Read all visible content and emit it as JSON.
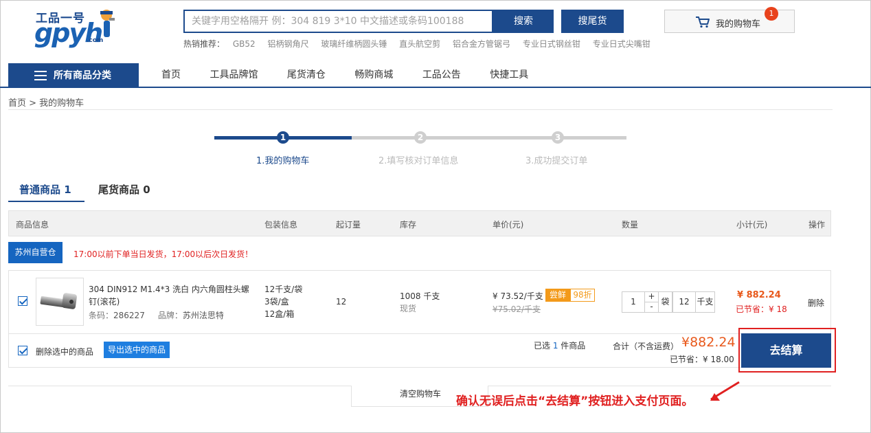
{
  "logo": {
    "cn": "工品一号",
    "en": "gpyh",
    "com": ".com"
  },
  "search": {
    "placeholder": "关键字用空格隔开 例：304 819 3*10 中文描述或条码100188",
    "search_btn": "搜索",
    "tail_btn": "搜尾货"
  },
  "hot": {
    "label": "热销推荐：",
    "keywords": [
      "GB52",
      "铝柄钢角尺",
      "玻璃纤维柄圆头锤",
      "直头航空剪",
      "铝合金方管锯弓",
      "专业日式钢丝钳",
      "专业日式尖嘴钳"
    ]
  },
  "cart": {
    "label": "我的购物车",
    "count": "1"
  },
  "nav": {
    "all_categories": "所有商品分类",
    "items": [
      "首页",
      "工具品牌馆",
      "尾货清仓",
      "畅购商城",
      "工品公告",
      "快捷工具"
    ]
  },
  "breadcrumb": "首页 > 我的购物车",
  "steps": [
    {
      "num": "1",
      "label": "1.我的购物车",
      "active": true
    },
    {
      "num": "2",
      "label": "2.填写核对订单信息",
      "active": false
    },
    {
      "num": "3",
      "label": "3.成功提交订单",
      "active": false
    }
  ],
  "tabs": [
    {
      "label": "普通商品",
      "count": "1"
    },
    {
      "label": "尾货商品",
      "count": "0"
    }
  ],
  "table_headers": [
    "商品信息",
    "包装信息",
    "起订量",
    "库存",
    "单价(元)",
    "数量",
    "小计(元)",
    "操作"
  ],
  "warehouse": {
    "label": "苏州自营仓",
    "note": "17:00以前下单当日发货，17:00以后次日发货！"
  },
  "item": {
    "name": "304   DIN912   M1.4*3     洗白   内六角圆柱头螺钉(滚花)",
    "code_label": "条码：",
    "code": "286227",
    "brand_label": "品牌：",
    "brand": "苏州法思特",
    "packing": [
      "12千支/袋",
      "3袋/盒",
      "12盒/箱"
    ],
    "moq": "12",
    "stock": "1008  千支",
    "stock_status": "现货",
    "price": "¥ 73.52/千支",
    "price_old": "¥75.02/千支",
    "tag_try": "尝鲜",
    "tag_discount": "98折",
    "qty_bags": "1",
    "qty_bag_unit": "袋",
    "qty_units": "12",
    "qty_unit": "千支",
    "subtotal": "¥  882.24",
    "saved": "已节省：¥ 18",
    "delete": "删除"
  },
  "footer": {
    "delete_selected": "删除选中的商品",
    "export_selected": "导出选中的商品",
    "selected_count_prefix": "已选 ",
    "selected_count": "1",
    "selected_count_suffix": " 件商品",
    "total_label": "合计（不含运费）",
    "total": "¥882.24",
    "saved_total": "已节省：¥ 18.00",
    "checkout": "去结算"
  },
  "clear_cart": "清空购物车",
  "hint": "确认无误后点击“去结算”按钮进入支付页面。",
  "colors": {
    "primary": "#1c4a8c",
    "accent": "#e8591c",
    "alert": "#e02020"
  }
}
